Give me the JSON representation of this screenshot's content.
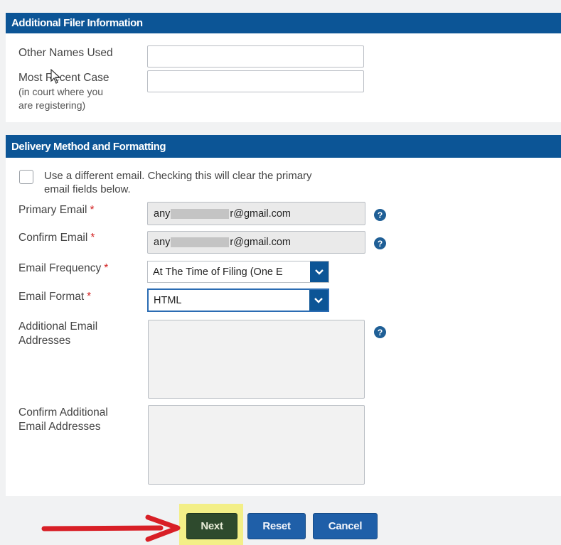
{
  "sections": {
    "additional_filer": {
      "title": "Additional Filer Information"
    },
    "delivery": {
      "title": "Delivery Method and Formatting"
    }
  },
  "additional_filer": {
    "other_names_label": "Other Names Used",
    "other_names_value": "",
    "recent_case_label": "Most Recent Case",
    "recent_case_sublabel_1": "(in court where you",
    "recent_case_sublabel_2": "are registering)",
    "recent_case_value": ""
  },
  "delivery": {
    "checkbox_label_1": "Use a different email. Checking this will clear the primary",
    "checkbox_label_2": "email fields below.",
    "checkbox_checked": false,
    "primary_email_label": "Primary Email",
    "primary_email_prefix": "any",
    "primary_email_suffix": "r@gmail.com",
    "confirm_email_label": "Confirm Email",
    "confirm_email_prefix": "any",
    "confirm_email_suffix": "r@gmail.com",
    "required_mark": "*",
    "email_frequency_label": "Email Frequency",
    "email_frequency_value": "At The Time of Filing (One E",
    "email_format_label": "Email Format",
    "email_format_value": "HTML",
    "additional_emails_label_1": "Additional Email",
    "additional_emails_label_2": "Addresses",
    "confirm_additional_label_1": "Confirm Additional",
    "confirm_additional_label_2": "Email Addresses",
    "help_glyph": "?"
  },
  "buttons": {
    "next": "Next",
    "reset": "Reset",
    "cancel": "Cancel"
  },
  "colors": {
    "header_blue": "#0c5596",
    "button_blue": "#1f5fa8",
    "next_green": "#2e4a2d",
    "highlight_yellow": "#f3ef87",
    "arrow_red": "#d81f26",
    "required_red": "#d21f1f"
  },
  "icons": {
    "help": "question-circle-icon",
    "dropdown": "chevron-down-icon",
    "arrow": "red-arrow-annotation",
    "cursor": "mouse-pointer-icon"
  }
}
